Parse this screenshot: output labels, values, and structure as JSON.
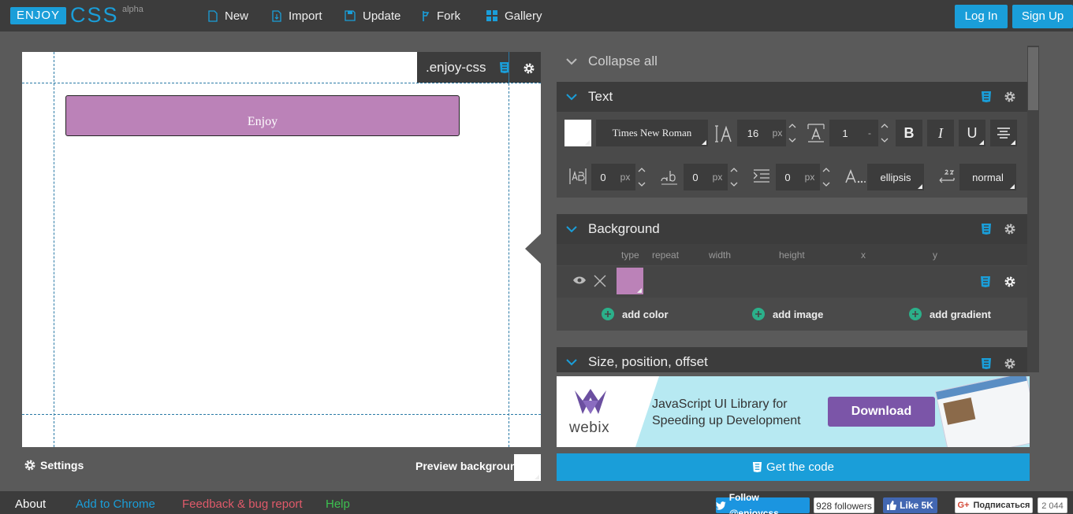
{
  "logo": {
    "enjoy": "ENJOY",
    "css": "CSS",
    "tag": "alpha"
  },
  "nav": [
    {
      "label": "New",
      "icon": "file-icon"
    },
    {
      "label": "Import",
      "icon": "import-icon"
    },
    {
      "label": "Update",
      "icon": "save-icon"
    },
    {
      "label": "Fork",
      "icon": "fork-icon"
    },
    {
      "label": "Gallery",
      "icon": "grid-icon"
    }
  ],
  "auth": {
    "login": "Log In",
    "signup": "Sign Up"
  },
  "preview": {
    "selector": ".enjoy-css",
    "button_text": "Enjoy",
    "button_bg": "#bb82b8",
    "settings": "Settings",
    "preview_bg": "Preview background"
  },
  "panel": {
    "collapse_all": "Collapse all",
    "text": {
      "title": "Text",
      "font_family": "Times New Roman",
      "font_size": "16",
      "font_size_unit": "px",
      "line_height": "1",
      "line_height_unit": "-",
      "bold": "B",
      "italic": "I",
      "underline": "U",
      "letter_spacing": "0",
      "letter_spacing_unit": "px",
      "word_spacing": "0",
      "word_spacing_unit": "px",
      "indent": "0",
      "indent_unit": "px",
      "overflow": "ellipsis",
      "white_space": "normal"
    },
    "background": {
      "title": "Background",
      "columns": [
        "type",
        "repeat",
        "width",
        "height",
        "x",
        "y"
      ],
      "layer_color": "#bb82b8",
      "add_color": "add color",
      "add_image": "add image",
      "add_gradient": "add gradient"
    },
    "size": {
      "title": "Size, position, offset"
    }
  },
  "ad": {
    "brand": "webix",
    "line1": "JavaScript UI Library for",
    "line2": "Speeding up Development",
    "button": "Download"
  },
  "get_code": "Get the code",
  "footer": {
    "about": "About",
    "chrome": "Add to Chrome",
    "feedback": "Feedback & bug report",
    "help": "Help",
    "twitter": "Follow @enjoycss",
    "followers": "928 followers",
    "like": "Like 5K",
    "gplus": "Подписаться",
    "gplus_count": "2 044"
  }
}
